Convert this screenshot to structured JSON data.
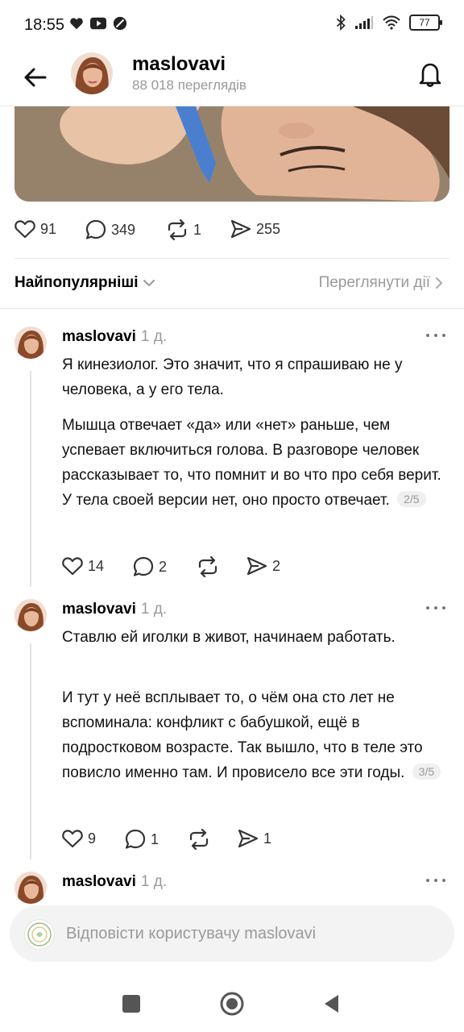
{
  "status_bar": {
    "time": "18:55",
    "battery": "77"
  },
  "header": {
    "username": "maslovavi",
    "views": "88 018 переглядів"
  },
  "post": {
    "likes": "91",
    "comments": "349",
    "reposts": "1",
    "shares": "255"
  },
  "sort": {
    "label": "Найпопулярніші",
    "activity_label": "Переглянути дії"
  },
  "comments": [
    {
      "author": "maslovavi",
      "age": "1 д.",
      "paragraphs": [
        "Я кинезиолог. Это значит, что я спрашиваю не у человека, а у его тела.",
        "Мышца отвечает «да» или «нет» раньше, чем успевает включиться голова. В разговоре человек рассказывает то, что помнит и во что про себя верит. У тела своей версии нет, оно просто отвечает."
      ],
      "page": "2/5",
      "likes": "14",
      "replies": "2",
      "shares": "2"
    },
    {
      "author": "maslovavi",
      "age": "1 д.",
      "paragraphs": [
        "Ставлю ей иголки в живот, начинаем работать.",
        "И тут у неё всплывает то, о чём она сто лет не вспоминала: конфликт с бабушкой, ещё в подростковом возрасте. Так вышло, что в теле это повисло именно там. И провисело все эти годы."
      ],
      "page": "3/5",
      "likes": "9",
      "replies": "1",
      "shares": "1"
    },
    {
      "author": "maslovavi",
      "age": "1 д."
    }
  ],
  "reply": {
    "placeholder": "Відповісти користувачу maslovavi"
  }
}
